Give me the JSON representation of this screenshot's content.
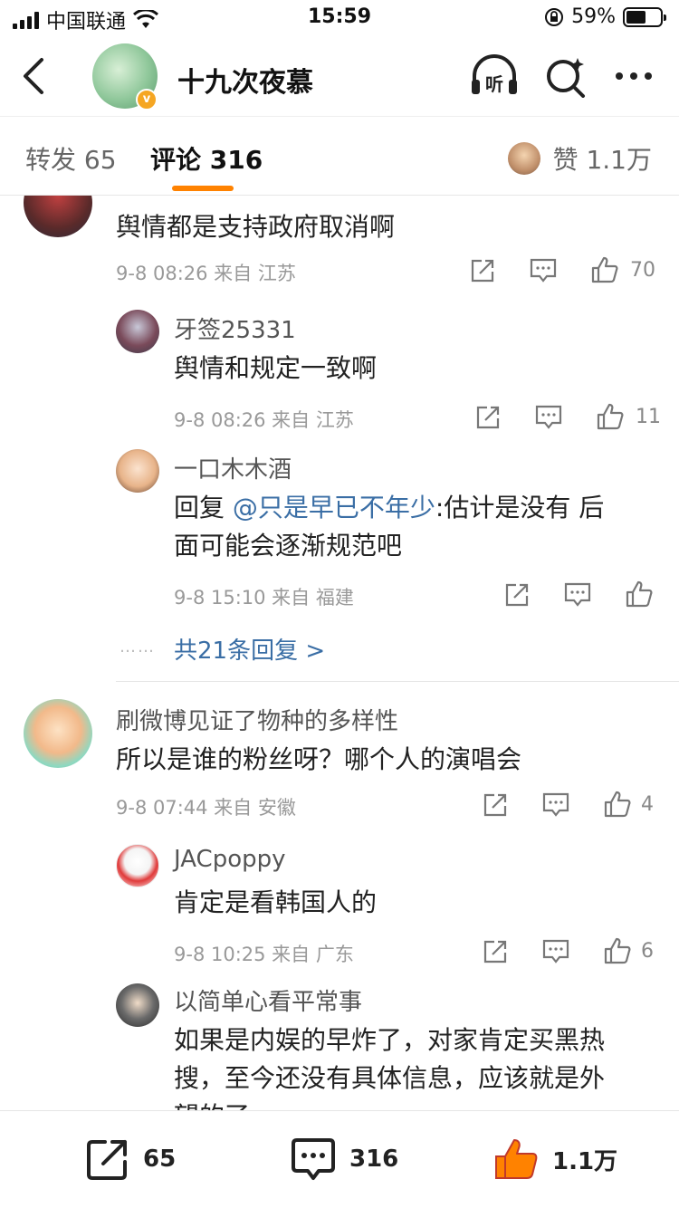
{
  "status_bar": {
    "carrier": "中国联通",
    "time": "15:59",
    "battery": "59%",
    "battery_level": 0.59
  },
  "header": {
    "title": "十九次夜慕",
    "verified_badge": "v",
    "icons": [
      "back-icon",
      "listen-icon",
      "search-icon",
      "more-icon"
    ],
    "listen_label": "听"
  },
  "tabs": {
    "repost": "转发 65",
    "comment": "评论 316",
    "likes": "赞 1.1万"
  },
  "comments": [
    {
      "text": "舆情都是支持政府取消啊",
      "meta": "9-8 08:26  来自 江苏",
      "likes": "70",
      "replies": [
        {
          "name": "牙签25331",
          "text": "舆情和规定一致啊",
          "meta": "9-8 08:26  来自 江苏",
          "likes": "11"
        },
        {
          "name": "一口木木酒",
          "reply_prefix": "回复 ",
          "mention": "@只是早已不年少",
          "text_line1": ":估计是没有 后",
          "text_line2": "面可能会逐渐规范吧",
          "meta": "9-8 15:10  来自 福建",
          "likes": ""
        }
      ],
      "more": "共21条回复 >",
      "dots": "……"
    },
    {
      "name": "刷微博见证了物种的多样性",
      "text": "所以是谁的粉丝呀？哪个人的演唱会",
      "meta": "9-8 07:44  来自 安徽",
      "likes": "4",
      "replies": [
        {
          "name": "JACpoppy",
          "text": "肯定是看韩国人的",
          "meta": "9-8 10:25  来自 广东",
          "likes": "6"
        },
        {
          "name": "以简单心看平常事",
          "text_line1": "如果是内娱的早炸了，对家肯定买黑热",
          "text_line2": "搜，至今还没有具体信息，应该就是外",
          "text_line3": "望的了"
        }
      ]
    }
  ],
  "bottom_bar": {
    "repost": "65",
    "comment": "316",
    "like": "1.1万"
  },
  "colors": {
    "accent": "#ff8200",
    "link": "#3a6ea5"
  }
}
